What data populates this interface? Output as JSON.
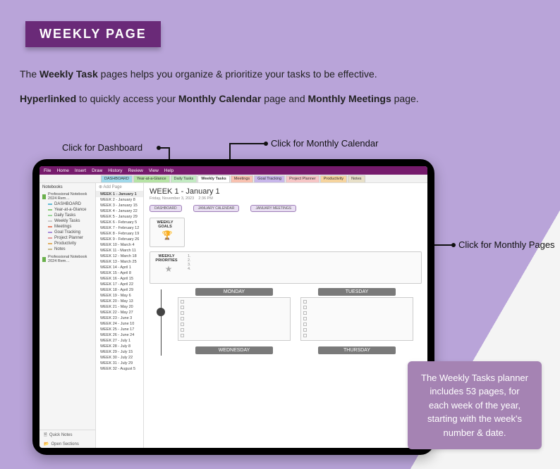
{
  "badge": "WEEKLY PAGE",
  "intro": {
    "l1a": "The ",
    "l1b": "Weekly Task",
    "l1c": " pages helps you organize & prioritize your tasks to be effective.",
    "l2a": "Hyperlinked",
    "l2b": " to quickly access your ",
    "l2c": "Monthly Calendar",
    "l2d": " page and ",
    "l2e": "Monthly Meetings",
    "l2f": " page."
  },
  "callout": {
    "dashboard": "Click for Dashboard",
    "calendar": "Click for Monthly Calendar",
    "pages": "Click for Monthly Pages"
  },
  "menubar": [
    "File",
    "Home",
    "Insert",
    "Draw",
    "History",
    "Review",
    "View",
    "Help"
  ],
  "notebooks_label": "Notebooks",
  "notebook1": "Professional Notebook 2024 Rem…",
  "notebook2": "Professional Notebook 2024 Rem…",
  "sidebar_items": [
    {
      "label": "DASHBOARD",
      "c": "#62bcd6"
    },
    {
      "label": "Year-at-a-Glance",
      "c": "#8cc97a"
    },
    {
      "label": "Daily Tasks",
      "c": "#9cd69c"
    },
    {
      "label": "Weekly Tasks",
      "c": "#cccccc"
    },
    {
      "label": "Meetings",
      "c": "#e7836a"
    },
    {
      "label": "Goal Tracking",
      "c": "#a88dd9"
    },
    {
      "label": "Project Planner",
      "c": "#e39a9a"
    },
    {
      "label": "Productivity",
      "c": "#e0ae62"
    },
    {
      "label": "Notes",
      "c": "#c6b98c"
    }
  ],
  "sidebar_bottom": {
    "quick": "Quick Notes",
    "open": "Open Sections"
  },
  "section_tabs": {
    "dash": "DASHBOARD",
    "yaag": "Year-at-a-Glance",
    "dt": "Daily Tasks",
    "wt": "Weekly Tasks",
    "mt": "Meetings",
    "gt": "Goal Tracking",
    "pp": "Project Planner",
    "pr": "Productivity",
    "nt": "Notes"
  },
  "pagelist_add": "Add Page",
  "pages": [
    "WEEK 1 - January 1",
    "WEEK 2 - January 8",
    "WEEK 3 - January 15",
    "WEEK 4 - January 22",
    "WEEK 5 - January 29",
    "WEEK 6 - February 5",
    "WEEK 7 - February 12",
    "WEEK 8 - February 19",
    "WEEK 9 - February 26",
    "WEEK 10 - March 4",
    "WEEK 11 - March 11",
    "WEEK 12 - March 18",
    "WEEK 13 - March 25",
    "WEEK 14 - April 1",
    "WEEK 15 - April 8",
    "WEEK 16 - April 15",
    "WEEK 17 - April 22",
    "WEEK 18 - April 29",
    "WEEK 19 - May 6",
    "WEEK 20 - May 13",
    "WEEK 21 - May 20",
    "WEEK 22 - May 27",
    "WEEK 23 - June 3",
    "WEEK 24 - June 10",
    "WEEK 25 - June 17",
    "WEEK 26 - June 24",
    "WEEK 27 - July 1",
    "WEEK 28 - July 8",
    "WEEK 29 - July 15",
    "WEEK 30 - July 22",
    "WEEK 31 - July 29",
    "WEEK 32 - August 5"
  ],
  "content": {
    "title": "WEEK 1 - January 1",
    "meta_date": "Friday, November 3, 2023",
    "meta_time": "2:36 PM",
    "btn_dash": "DASHBOARD",
    "btn_cal": "JANUARY CALENDAR",
    "btn_meet": "JANUARY MEETINGS",
    "goals_title": "WEEKLY GOALS",
    "prio_title": "WEEKLY PRIORITIES",
    "prio_nums": "1.\n2.\n3.\n4.",
    "days": {
      "mon": "MONDAY",
      "tue": "TUESDAY",
      "wed": "WEDNESDAY",
      "thu": "THURSDAY"
    }
  },
  "infobox": "The Weekly Tasks planner includes 53 pages, for each week of the year, starting with the week's number & date."
}
